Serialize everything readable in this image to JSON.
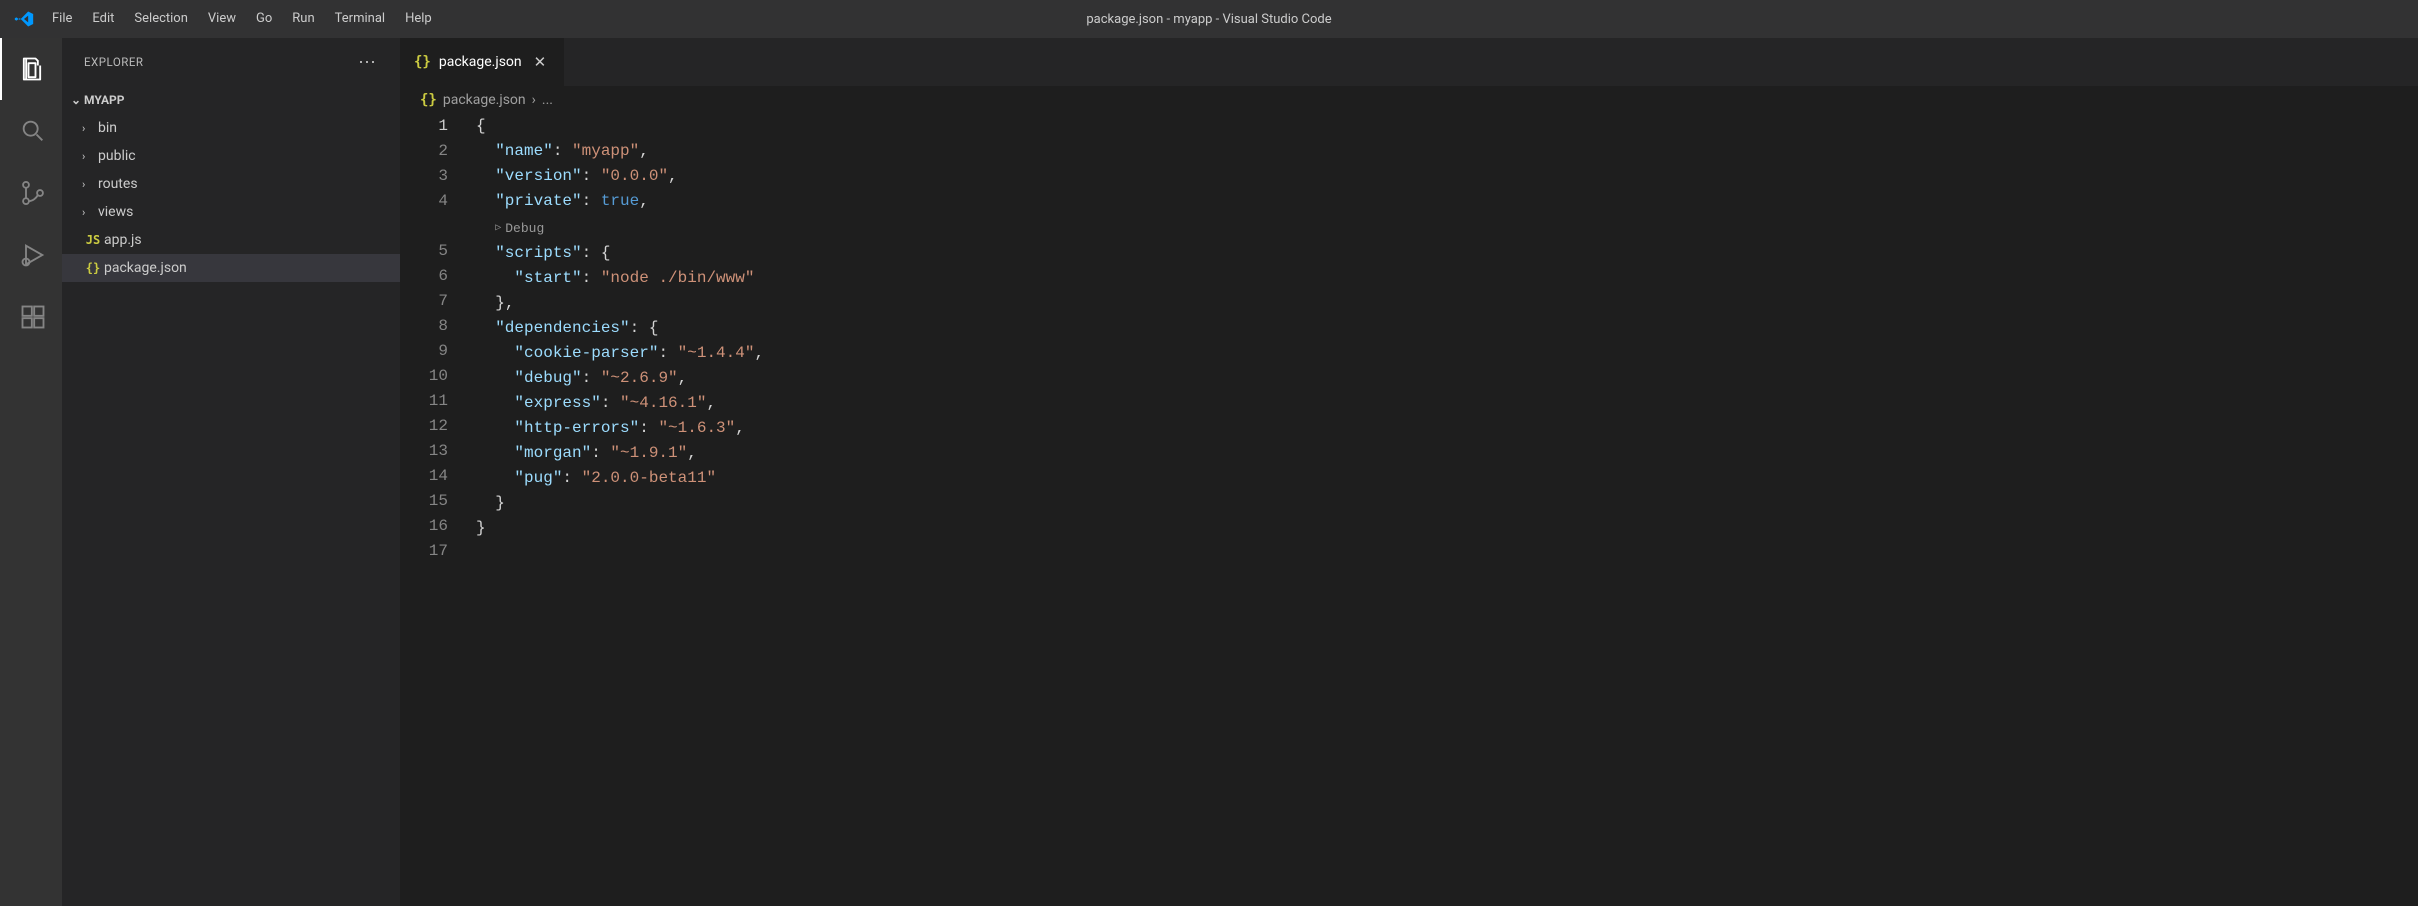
{
  "titleBar": {
    "title": "package.json - myapp - Visual Studio Code",
    "menu": [
      "File",
      "Edit",
      "Selection",
      "View",
      "Go",
      "Run",
      "Terminal",
      "Help"
    ]
  },
  "sidebar": {
    "title": "EXPLORER",
    "project": "MYAPP",
    "tree": [
      {
        "kind": "folder",
        "name": "bin"
      },
      {
        "kind": "folder",
        "name": "public"
      },
      {
        "kind": "folder",
        "name": "routes"
      },
      {
        "kind": "folder",
        "name": "views"
      },
      {
        "kind": "file",
        "name": "app.js",
        "icon": "JS"
      },
      {
        "kind": "file",
        "name": "package.json",
        "icon": "{}",
        "selected": true
      }
    ]
  },
  "tabs": {
    "active": {
      "name": "package.json",
      "icon": "{}"
    }
  },
  "breadcrumb": {
    "file": "package.json",
    "tail": "..."
  },
  "codeLens": "Debug",
  "code": {
    "lines": [
      {
        "n": 1,
        "indent": 0,
        "segs": [
          {
            "t": "{",
            "c": "brace"
          }
        ],
        "active": true
      },
      {
        "n": 2,
        "indent": 1,
        "segs": [
          {
            "t": "\"name\"",
            "c": "key"
          },
          {
            "t": ": ",
            "c": "punct"
          },
          {
            "t": "\"myapp\"",
            "c": "str"
          },
          {
            "t": ",",
            "c": "punct"
          }
        ]
      },
      {
        "n": 3,
        "indent": 1,
        "segs": [
          {
            "t": "\"version\"",
            "c": "key"
          },
          {
            "t": ": ",
            "c": "punct"
          },
          {
            "t": "\"0.0.0\"",
            "c": "str"
          },
          {
            "t": ",",
            "c": "punct"
          }
        ]
      },
      {
        "n": 4,
        "indent": 1,
        "segs": [
          {
            "t": "\"private\"",
            "c": "key"
          },
          {
            "t": ": ",
            "c": "punct"
          },
          {
            "t": "true",
            "c": "bool"
          },
          {
            "t": ",",
            "c": "punct"
          }
        ]
      },
      {
        "lens": true
      },
      {
        "n": 5,
        "indent": 1,
        "segs": [
          {
            "t": "\"scripts\"",
            "c": "key"
          },
          {
            "t": ": ",
            "c": "punct"
          },
          {
            "t": "{",
            "c": "brace"
          }
        ]
      },
      {
        "n": 6,
        "indent": 2,
        "segs": [
          {
            "t": "\"start\"",
            "c": "key"
          },
          {
            "t": ": ",
            "c": "punct"
          },
          {
            "t": "\"node ./bin/www\"",
            "c": "str"
          }
        ]
      },
      {
        "n": 7,
        "indent": 1,
        "segs": [
          {
            "t": "}",
            "c": "brace"
          },
          {
            "t": ",",
            "c": "punct"
          }
        ]
      },
      {
        "n": 8,
        "indent": 1,
        "segs": [
          {
            "t": "\"dependencies\"",
            "c": "key"
          },
          {
            "t": ": ",
            "c": "punct"
          },
          {
            "t": "{",
            "c": "brace"
          }
        ]
      },
      {
        "n": 9,
        "indent": 2,
        "segs": [
          {
            "t": "\"cookie-parser\"",
            "c": "key"
          },
          {
            "t": ": ",
            "c": "punct"
          },
          {
            "t": "\"~1.4.4\"",
            "c": "str"
          },
          {
            "t": ",",
            "c": "punct"
          }
        ]
      },
      {
        "n": 10,
        "indent": 2,
        "segs": [
          {
            "t": "\"debug\"",
            "c": "key"
          },
          {
            "t": ": ",
            "c": "punct"
          },
          {
            "t": "\"~2.6.9\"",
            "c": "str"
          },
          {
            "t": ",",
            "c": "punct"
          }
        ]
      },
      {
        "n": 11,
        "indent": 2,
        "segs": [
          {
            "t": "\"express\"",
            "c": "key"
          },
          {
            "t": ": ",
            "c": "punct"
          },
          {
            "t": "\"~4.16.1\"",
            "c": "str"
          },
          {
            "t": ",",
            "c": "punct"
          }
        ]
      },
      {
        "n": 12,
        "indent": 2,
        "segs": [
          {
            "t": "\"http-errors\"",
            "c": "key"
          },
          {
            "t": ": ",
            "c": "punct"
          },
          {
            "t": "\"~1.6.3\"",
            "c": "str"
          },
          {
            "t": ",",
            "c": "punct"
          }
        ]
      },
      {
        "n": 13,
        "indent": 2,
        "segs": [
          {
            "t": "\"morgan\"",
            "c": "key"
          },
          {
            "t": ": ",
            "c": "punct"
          },
          {
            "t": "\"~1.9.1\"",
            "c": "str"
          },
          {
            "t": ",",
            "c": "punct"
          }
        ]
      },
      {
        "n": 14,
        "indent": 2,
        "segs": [
          {
            "t": "\"pug\"",
            "c": "key"
          },
          {
            "t": ": ",
            "c": "punct"
          },
          {
            "t": "\"2.0.0-beta11\"",
            "c": "str"
          }
        ]
      },
      {
        "n": 15,
        "indent": 1,
        "segs": [
          {
            "t": "}",
            "c": "brace"
          }
        ]
      },
      {
        "n": 16,
        "indent": 0,
        "segs": [
          {
            "t": "}",
            "c": "brace"
          }
        ]
      },
      {
        "n": 17,
        "indent": 0,
        "segs": []
      }
    ]
  }
}
